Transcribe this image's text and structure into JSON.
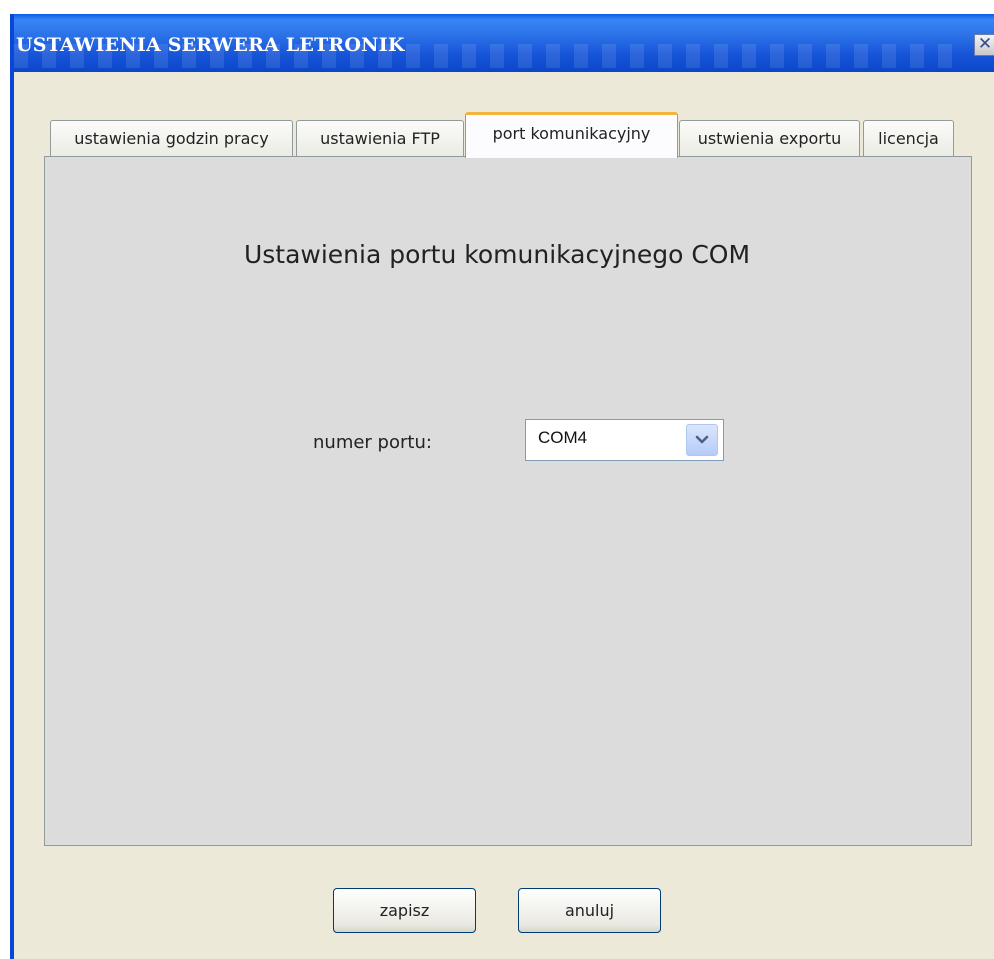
{
  "window": {
    "title": "USTAWIENIA SERWERA LETRONIK",
    "close_icon": "close-icon"
  },
  "tabs": [
    {
      "label": "ustawienia godzin pracy",
      "active": false
    },
    {
      "label": "ustawienia FTP",
      "active": false
    },
    {
      "label": "port komunikacyjny",
      "active": true
    },
    {
      "label": "ustwienia exportu",
      "active": false
    },
    {
      "label": "licencja",
      "active": false
    }
  ],
  "panel": {
    "heading": "Ustawienia portu komunikacyjnego COM",
    "port_label": "numer portu:",
    "port_select": {
      "value": "COM4",
      "arrow_icon": "chevron-down-icon"
    }
  },
  "buttons": {
    "save": "zapisz",
    "cancel": "anuluj"
  },
  "colors": {
    "titlebar": "#0b47c8",
    "active_tab_accent": "#f3b43f",
    "dialog_background": "#ece9d8",
    "panel_background": "#dcdcdc"
  }
}
